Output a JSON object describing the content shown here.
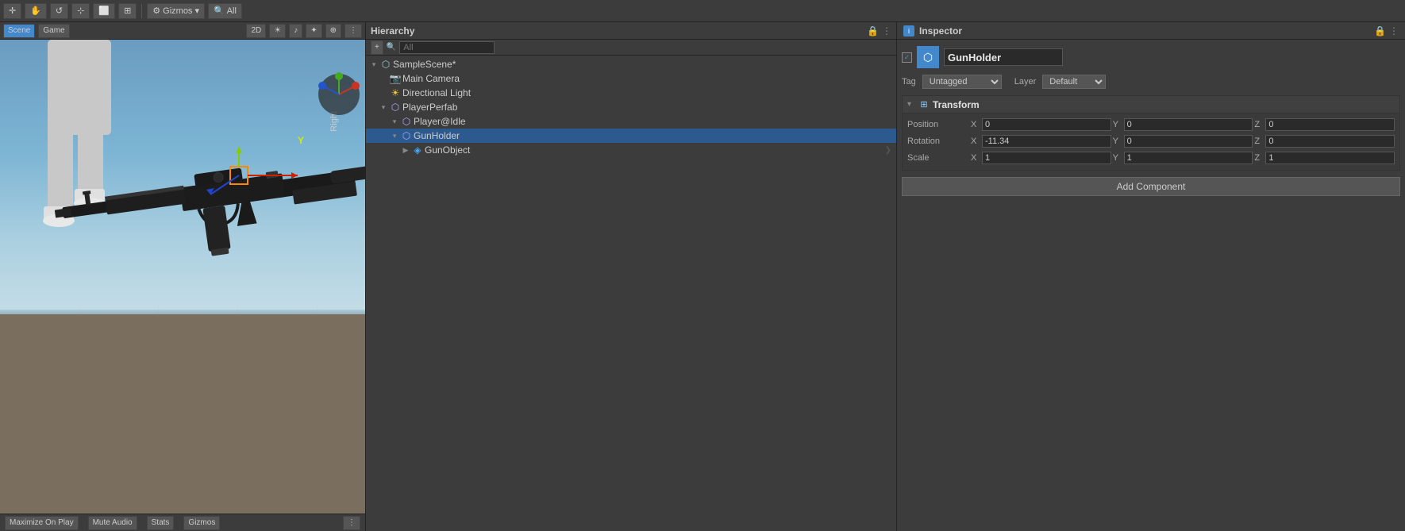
{
  "toolbar": {
    "tools": [
      "move_icon",
      "rotate_icon",
      "scale_icon"
    ],
    "gizmos_label": "Gizmos",
    "all_label": "All",
    "menu_icon": "⋮"
  },
  "scene_view": {
    "toolbar_buttons": [
      {
        "label": "Maximize On Play",
        "name": "maximize-on-play"
      },
      {
        "label": "Mute Audio",
        "name": "mute-audio"
      },
      {
        "label": "Stats",
        "name": "stats"
      },
      {
        "label": "Gizmos",
        "name": "gizmos-toggle"
      }
    ],
    "right_label": "Right"
  },
  "hierarchy": {
    "title": "Hierarchy",
    "search_placeholder": "All",
    "items": [
      {
        "id": "sample-scene",
        "label": "SampleScene*",
        "indent": 0,
        "expanded": true,
        "icon": "scene",
        "type": "scene"
      },
      {
        "id": "main-camera",
        "label": "Main Camera",
        "indent": 1,
        "expanded": false,
        "icon": "camera",
        "type": "camera"
      },
      {
        "id": "directional-light",
        "label": "Directional Light",
        "indent": 1,
        "expanded": false,
        "icon": "light",
        "type": "light"
      },
      {
        "id": "player-perfab",
        "label": "PlayerPerfab",
        "indent": 1,
        "expanded": true,
        "icon": "gameobj",
        "type": "gameobj"
      },
      {
        "id": "player-idle",
        "label": "Player@Idle",
        "indent": 2,
        "expanded": false,
        "icon": "gameobj",
        "type": "gameobj"
      },
      {
        "id": "gun-holder",
        "label": "GunHolder",
        "indent": 2,
        "expanded": true,
        "icon": "gameobj",
        "type": "gameobj"
      },
      {
        "id": "gun-object",
        "label": "GunObject",
        "indent": 3,
        "expanded": false,
        "icon": "gameobj",
        "type": "gameobj_blue",
        "has_arrow": true
      }
    ]
  },
  "inspector": {
    "title": "Inspector",
    "gameobject_name": "GunHolder",
    "checkbox_checked": true,
    "tag_label": "Tag",
    "tag_value": "Untagged",
    "layer_label": "Layer",
    "layer_value": "Default",
    "transform": {
      "section_name": "Transform",
      "position": {
        "label": "Position",
        "x": "0",
        "y": "0",
        "z": "0"
      },
      "rotation": {
        "label": "Rotation",
        "x": "-11.34",
        "y": "0",
        "z": "0"
      },
      "scale": {
        "label": "Scale",
        "x": "1",
        "y": "1",
        "z": "1"
      }
    },
    "add_component_label": "Add Component"
  }
}
